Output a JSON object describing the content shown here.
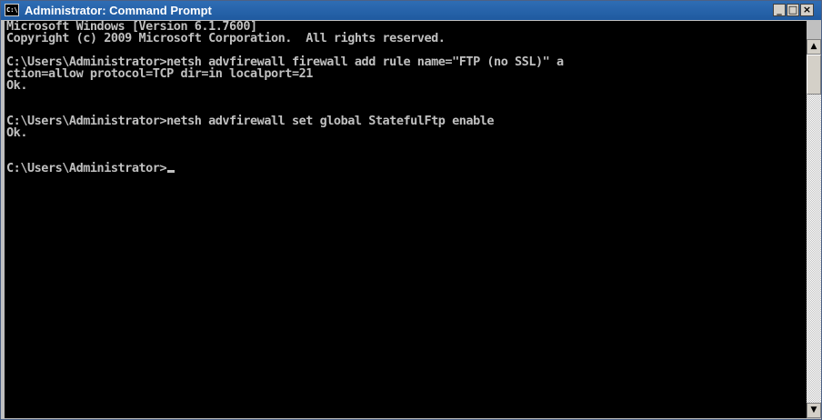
{
  "window": {
    "title": "Administrator: Command Prompt",
    "icon_text": "C:\\",
    "controls": {
      "minimize": "_",
      "maximize": "□",
      "close": "×"
    }
  },
  "console": {
    "lines": [
      "Microsoft Windows [Version 6.1.7600]",
      "Copyright (c) 2009 Microsoft Corporation.  All rights reserved.",
      "",
      "C:\\Users\\Administrator>netsh advfirewall firewall add rule name=\"FTP (no SSL)\" a",
      "ction=allow protocol=TCP dir=in localport=21",
      "Ok.",
      "",
      "",
      "C:\\Users\\Administrator>netsh advfirewall set global StatefulFtp enable",
      "Ok.",
      "",
      "",
      "C:\\Users\\Administrator>"
    ],
    "colors": {
      "background": "#000000",
      "text": "#c0c0c0"
    }
  },
  "scrollbar": {
    "up_arrow": "▲",
    "down_arrow": "▼"
  }
}
